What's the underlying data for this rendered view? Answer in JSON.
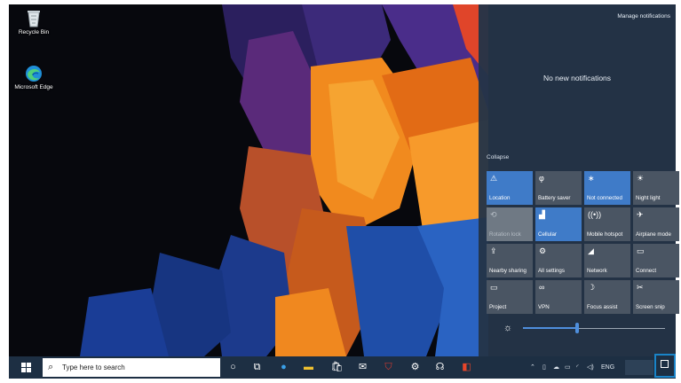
{
  "desktop": {
    "icons": [
      {
        "label": "Recycle Bin",
        "icon": "recycle-bin-icon"
      },
      {
        "label": "Microsoft Edge",
        "icon": "edge-icon"
      }
    ]
  },
  "action_center": {
    "manage_label": "Manage notifications",
    "empty_text": "No new notifications",
    "collapse_label": "Collapse",
    "tiles": [
      {
        "label": "Location",
        "icon": "location-icon",
        "state": "on"
      },
      {
        "label": "Battery saver",
        "icon": "battery-saver-icon",
        "state": "off"
      },
      {
        "label": "Not connected",
        "icon": "bluetooth-icon",
        "state": "on"
      },
      {
        "label": "Night light",
        "icon": "night-light-icon",
        "state": "off"
      },
      {
        "label": "Rotation lock",
        "icon": "rotation-lock-icon",
        "state": "disabled"
      },
      {
        "label": "Cellular",
        "icon": "cellular-icon",
        "state": "on"
      },
      {
        "label": "Mobile hotspot",
        "icon": "mobile-hotspot-icon",
        "state": "off"
      },
      {
        "label": "Airplane mode",
        "icon": "airplane-mode-icon",
        "state": "off"
      },
      {
        "label": "Nearby sharing",
        "icon": "nearby-sharing-icon",
        "state": "off"
      },
      {
        "label": "All settings",
        "icon": "settings-icon",
        "state": "off"
      },
      {
        "label": "Network",
        "icon": "network-icon",
        "state": "off"
      },
      {
        "label": "Connect",
        "icon": "connect-icon",
        "state": "off"
      },
      {
        "label": "Project",
        "icon": "project-icon",
        "state": "off"
      },
      {
        "label": "VPN",
        "icon": "vpn-icon",
        "state": "off"
      },
      {
        "label": "Focus assist",
        "icon": "focus-assist-icon",
        "state": "off"
      },
      {
        "label": "Screen snip",
        "icon": "screen-snip-icon",
        "state": "off"
      }
    ],
    "brightness": {
      "level": 0.38,
      "icon": "brightness-icon"
    }
  },
  "taskbar": {
    "search_placeholder": "Type here to search",
    "tray_language": "ENG",
    "accent": "#3f7bc8",
    "highlight": "#1a84c8"
  }
}
